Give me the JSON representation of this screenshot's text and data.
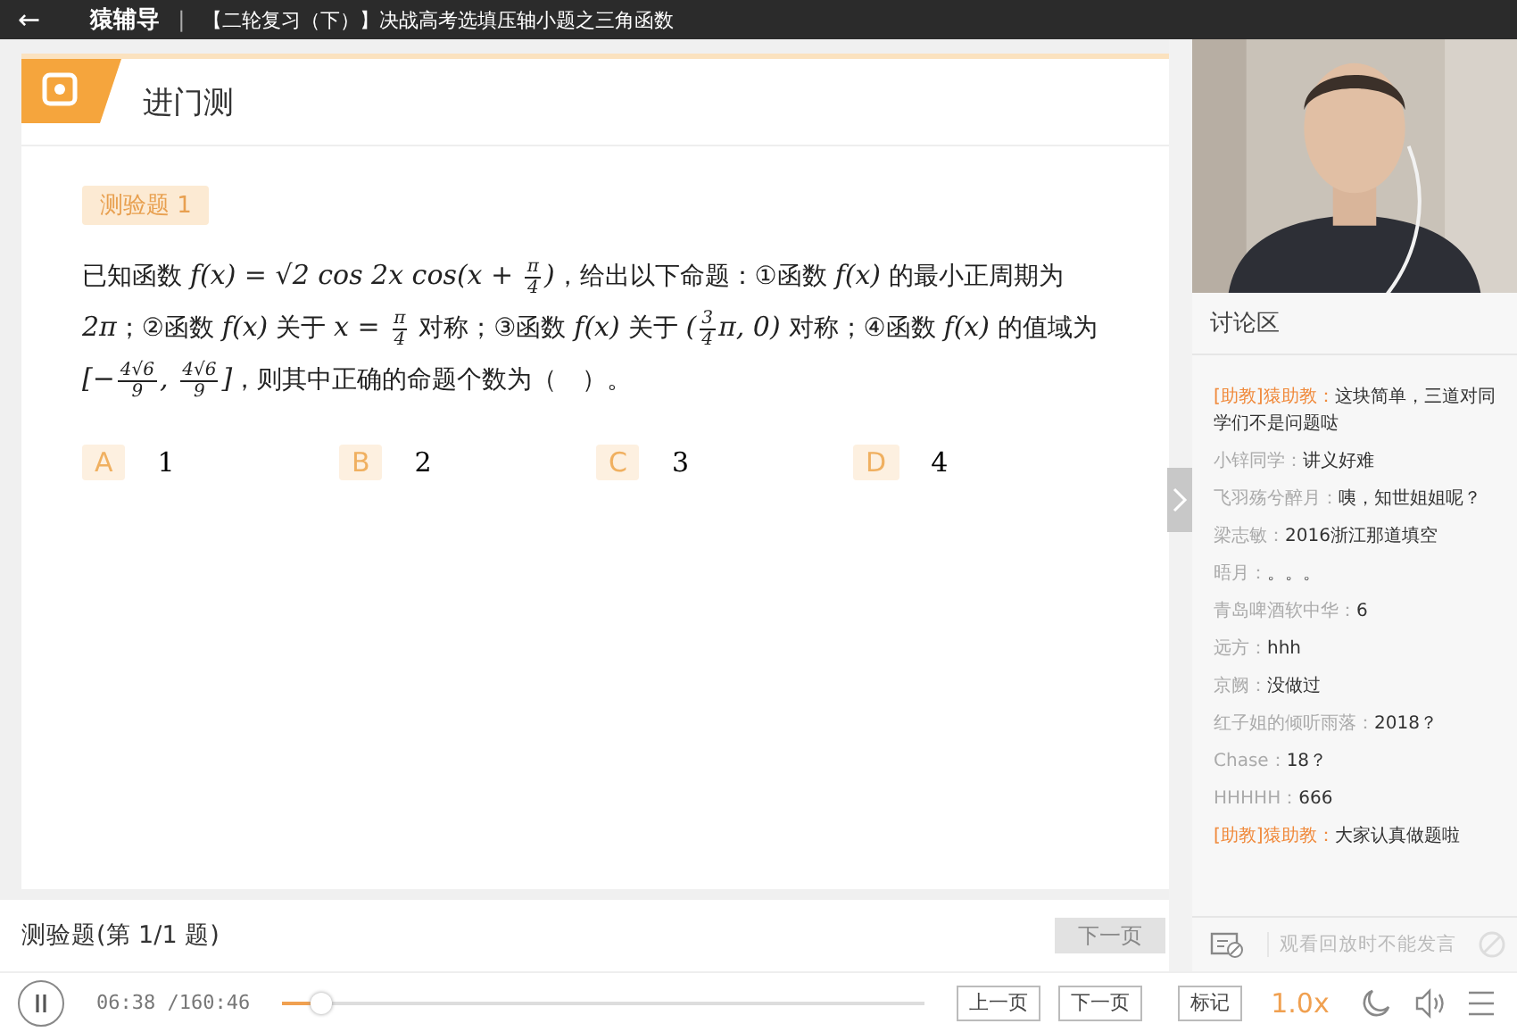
{
  "title_bar": {
    "back": "←",
    "app_name": "猿辅导",
    "separator": "|",
    "title": "【二轮复习（下）】决战高考选填压轴小题之三角函数"
  },
  "quiz": {
    "heading": "进门测",
    "tag": "测验题 1",
    "question": [
      {
        "kind": "text",
        "text": "已知函数 "
      },
      {
        "kind": "math",
        "text": "f(x) = √2 cos 2x cos(x + "
      },
      {
        "kind": "frac",
        "num": "π",
        "den": "4"
      },
      {
        "kind": "math",
        "text": ")"
      },
      {
        "kind": "text",
        "text": "，给出以下命题：①函数 "
      },
      {
        "kind": "math",
        "text": "f(x)"
      },
      {
        "kind": "text",
        "text": " 的最小正周期为 "
      },
      {
        "kind": "math",
        "text": "2π"
      },
      {
        "kind": "text",
        "text": "；②函数 "
      },
      {
        "kind": "math",
        "text": "f(x)"
      },
      {
        "kind": "text",
        "text": " 关于 "
      },
      {
        "kind": "math",
        "text": "x = "
      },
      {
        "kind": "frac",
        "num": "π",
        "den": "4"
      },
      {
        "kind": "text",
        "text": " 对称；③函数 "
      },
      {
        "kind": "math",
        "text": "f(x)"
      },
      {
        "kind": "text",
        "text": " 关于 "
      },
      {
        "kind": "math",
        "text": "("
      },
      {
        "kind": "frac",
        "num": "3",
        "den": "4"
      },
      {
        "kind": "math",
        "text": "π, 0)"
      },
      {
        "kind": "text",
        "text": " 对称；④函数 "
      },
      {
        "kind": "math",
        "text": "f(x)"
      },
      {
        "kind": "text",
        "text": " 的值域为 "
      },
      {
        "kind": "math",
        "text": "[−"
      },
      {
        "kind": "frac",
        "num": "4√6",
        "den": "9"
      },
      {
        "kind": "math",
        "text": ", "
      },
      {
        "kind": "frac",
        "num": "4√6",
        "den": "9"
      },
      {
        "kind": "math",
        "text": "]"
      },
      {
        "kind": "text",
        "text": "，则其中正确的命题个数为（　）。"
      }
    ],
    "options": [
      {
        "letter": "A",
        "text": "1",
        "selected": false
      },
      {
        "letter": "B",
        "text": "2",
        "selected": false
      },
      {
        "letter": "C",
        "text": "3",
        "selected": false
      },
      {
        "letter": "D",
        "text": "4",
        "selected": false
      }
    ],
    "footer": "测验题(第 1/1 题)",
    "next_button": {
      "label": "下一页",
      "disabled": true
    }
  },
  "discussion": {
    "heading": "讨论区",
    "messages": [
      {
        "kind": "assistant",
        "name": "[助教]猿助教：",
        "text": "这块简单，三道对同学们不是问题哒"
      },
      {
        "kind": "user",
        "name": "小锌同学：",
        "text": "讲义好难"
      },
      {
        "kind": "user",
        "name": "飞羽殇兮醉月：",
        "text": "咦，知世姐姐呢？"
      },
      {
        "kind": "user",
        "name": "梁志敏：",
        "text": "2016浙江那道填空"
      },
      {
        "kind": "user",
        "name": "晤月：",
        "text": "。。。"
      },
      {
        "kind": "user",
        "name": "青岛啤酒软中华：",
        "text": "6"
      },
      {
        "kind": "user",
        "name": "远方：",
        "text": "hhh"
      },
      {
        "kind": "user",
        "name": "京阙：",
        "text": "没做过"
      },
      {
        "kind": "user",
        "name": "红子姐的倾听雨落：",
        "text": "2018？"
      },
      {
        "kind": "user",
        "name": "Chase：",
        "text": "18？"
      },
      {
        "kind": "user",
        "name": "HHHHH：",
        "text": "666"
      },
      {
        "kind": "assistant",
        "name": "[助教]猿助教：",
        "text": "大家认真做题啦"
      }
    ],
    "input_placeholder": "观看回放时不能发言"
  },
  "player": {
    "playing": true,
    "time": "06:38 /160:46",
    "level": 0.05,
    "buttons": [
      "上一页",
      "下一页",
      "标记"
    ],
    "speed": "1.0x"
  }
}
